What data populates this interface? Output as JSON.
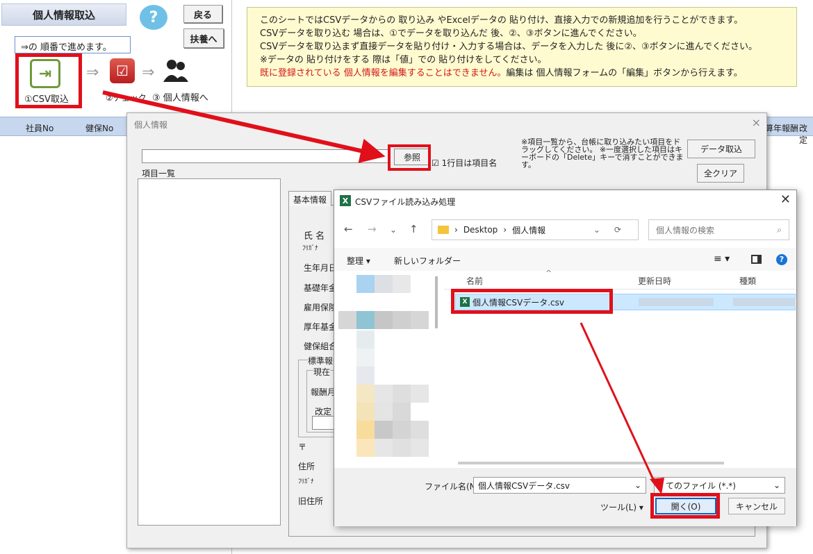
{
  "sheet": {
    "title": "個人情報取込",
    "help": "?",
    "back": "戻る",
    "dependents": "扶養へ",
    "steps_note": "⇒の 順番で進めます。",
    "step1": "①CSV取込",
    "step2": "②チェック",
    "step3": "③ 個人情報へ"
  },
  "info_lines": [
    "このシートではCSVデータからの 取り込み やExcelデータの 貼り付け、直接入力での新規追加を行うことができます。",
    "CSVデータを取り込む 場合は、①でデータを取り込んだ 後、②、③ボタンに進んでください。",
    "CSVデータを取り込まず直接データを貼り付け・入力する場合は、データを入力した 後に②、③ボタンに進んでください。",
    "※データの 貼り付けをする 際は「値」での 貼り付けをしてください。"
  ],
  "info_warning": "既に登録されている 個人情報を編集することはできません。",
  "info_tail": "編集は 個人情報フォームの「編集」ボタンから行えます。",
  "columns": {
    "c1": "社員No",
    "c2": "健保No",
    "c3": "算年報酬",
    "c4": "改定"
  },
  "form": {
    "title": "個人情報",
    "close": "×",
    "browse": "参照",
    "first_row": "1行目は項目名",
    "items_label": "項目一覧",
    "hint": "※項目一覧から、台帳に取り込みたい項目をドラッグしてください。 ※一度選択した項目はキーボードの「Delete」キーで消すことができます。",
    "import": "データ取込",
    "clear": "全クリア",
    "tab": "基本情報",
    "fields": [
      "氏 名",
      "ﾌﾘｶﾞﾅ",
      "生年月日",
      "基礎年金",
      "雇用保険",
      "厚年基金",
      "健保組合",
      "標準報",
      "現在",
      "報酬月",
      "改定",
      "〒",
      "住所",
      "ﾌﾘｶﾞﾅ",
      "旧住所"
    ]
  },
  "dialog": {
    "title": "CSVファイル読み込み処理",
    "close": "✕",
    "path1": "Desktop",
    "path2": "個人情報",
    "search": "個人情報の検索",
    "organize": "整理 ▾",
    "new_folder": "新しいフォルダー",
    "col_name": "名前",
    "col_date": "更新日時",
    "col_type": "種類",
    "file": "個人情報CSVデータ.csv",
    "fn_label": "ファイル名(N):",
    "fn_value": "個人情報CSVデータ.csv",
    "filter": "てのファイル (*.*)",
    "tools": "ツール(L)  ▾",
    "open": "開く(O)",
    "cancel": "キャンセル"
  },
  "colors": {
    "highlight": "#e0101a",
    "info_bg": "#fffbd0",
    "header_bg": "#c7d7ee"
  }
}
